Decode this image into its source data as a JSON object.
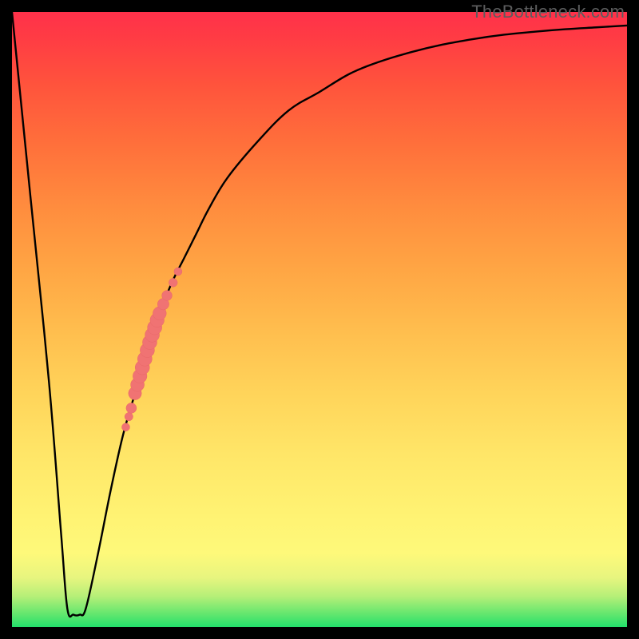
{
  "watermark": "TheBottleneck.com",
  "colors": {
    "curve": "#000000",
    "dots": "#f07373",
    "dots_stroke": "#e96868",
    "frame": "#000000"
  },
  "chart_data": {
    "type": "line",
    "title": "",
    "xlabel": "",
    "ylabel": "",
    "xlim": [
      0,
      100
    ],
    "ylim": [
      0,
      100
    ],
    "series": [
      {
        "name": "bottleneck-curve",
        "x": [
          0,
          3,
          6,
          8,
          9,
          10,
          11,
          12,
          14,
          16,
          18,
          20,
          22,
          24,
          26,
          28,
          30,
          32,
          35,
          40,
          45,
          50,
          55,
          60,
          65,
          70,
          75,
          80,
          85,
          90,
          95,
          100
        ],
        "y": [
          100,
          70,
          40,
          15,
          3,
          2,
          2,
          3,
          12,
          22,
          31,
          38,
          45,
          51,
          56,
          60,
          64,
          68,
          73,
          79,
          84,
          87,
          90,
          92,
          93.5,
          94.7,
          95.6,
          96.3,
          96.8,
          97.2,
          97.5,
          97.8
        ]
      }
    ],
    "markers": {
      "name": "highlight-dots",
      "on_series": "bottleneck-curve",
      "x": [
        18.5,
        19.0,
        19.4,
        20.0,
        20.4,
        20.8,
        21.2,
        21.6,
        22.0,
        22.4,
        22.8,
        23.2,
        23.6,
        24.0,
        24.6,
        25.2,
        26.2,
        27.0
      ],
      "y": [
        32.5,
        34.2,
        35.6,
        38.0,
        39.4,
        40.8,
        42.2,
        43.6,
        45.0,
        46.3,
        47.5,
        48.7,
        49.9,
        51.0,
        52.5,
        53.9,
        56.0,
        57.8
      ],
      "size": [
        5,
        5.2,
        6.5,
        8.2,
        8.5,
        8.8,
        9.0,
        9.0,
        9.0,
        9.0,
        9.0,
        9.0,
        8.8,
        8.4,
        7.2,
        6.4,
        5.4,
        5.0
      ]
    }
  }
}
